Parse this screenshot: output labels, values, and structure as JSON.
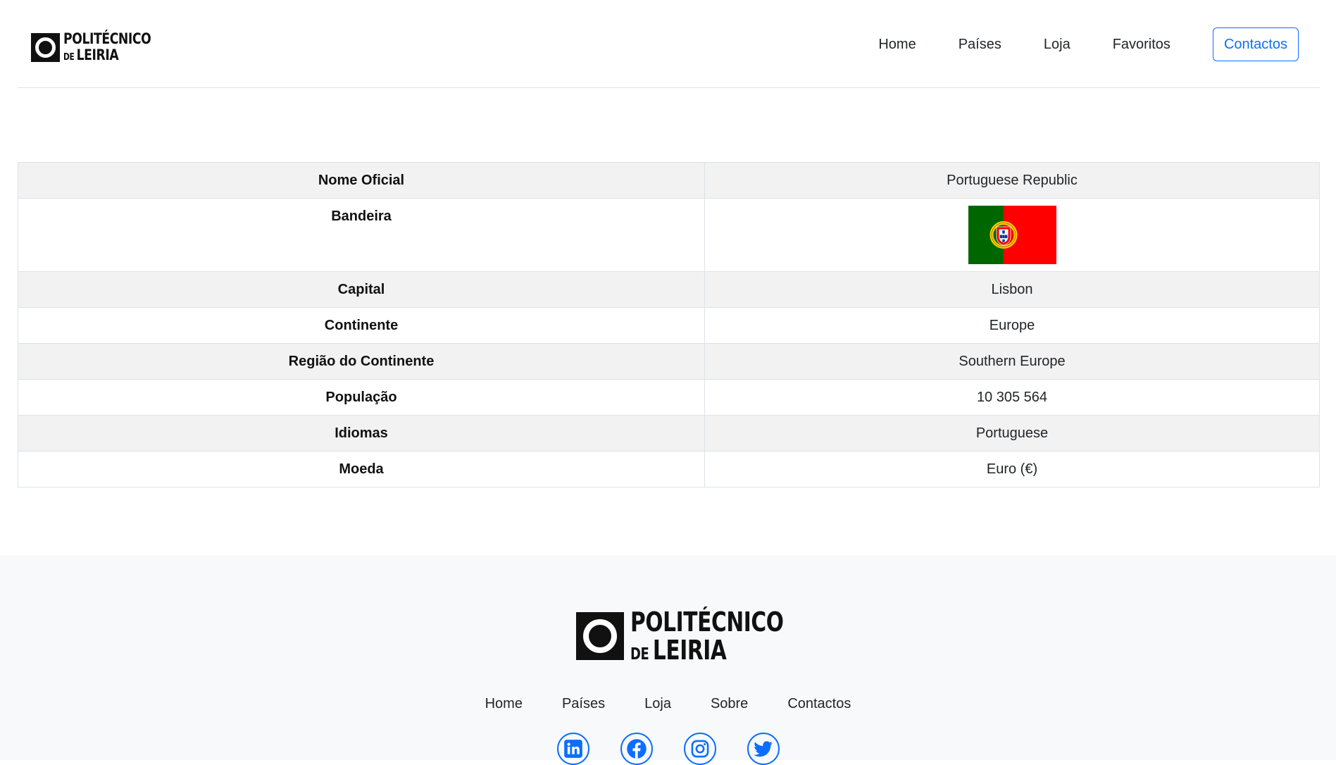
{
  "header": {
    "logo": {
      "line1": "POLITÉCNICO",
      "line2a": "DE",
      "line2b": "LEIRIA"
    },
    "nav": [
      {
        "label": "Home"
      },
      {
        "label": "Países"
      },
      {
        "label": "Loja"
      },
      {
        "label": "Favoritos"
      },
      {
        "label": "Contactos"
      }
    ]
  },
  "country": {
    "rows": [
      {
        "label": "Nome Oficial",
        "value": "Portuguese Republic"
      },
      {
        "label": "Bandeira",
        "flag": "portugal-flag",
        "flag_colors": [
          "#006600",
          "#ff0000",
          "#ffcc00"
        ]
      },
      {
        "label": "Capital",
        "value": "Lisbon"
      },
      {
        "label": "Continente",
        "value": "Europe"
      },
      {
        "label": "Região do Continente",
        "value": "Southern Europe"
      },
      {
        "label": "População",
        "value": "10 305 564"
      },
      {
        "label": "Idiomas",
        "value": "Portuguese"
      },
      {
        "label": "Moeda",
        "value": "Euro (€)"
      }
    ]
  },
  "footer": {
    "logo": {
      "line1": "POLITÉCNICO",
      "line2a": "DE",
      "line2b": "LEIRIA"
    },
    "nav": [
      {
        "label": "Home"
      },
      {
        "label": "Países"
      },
      {
        "label": "Loja"
      },
      {
        "label": "Sobre"
      },
      {
        "label": "Contactos"
      }
    ],
    "social": [
      "linkedin-icon",
      "facebook-icon",
      "instagram-icon",
      "twitter-icon"
    ]
  },
  "colors": {
    "accent": "#0d6efd",
    "footer_bg": "#f8f9fa",
    "stripe": "#f2f2f2"
  }
}
